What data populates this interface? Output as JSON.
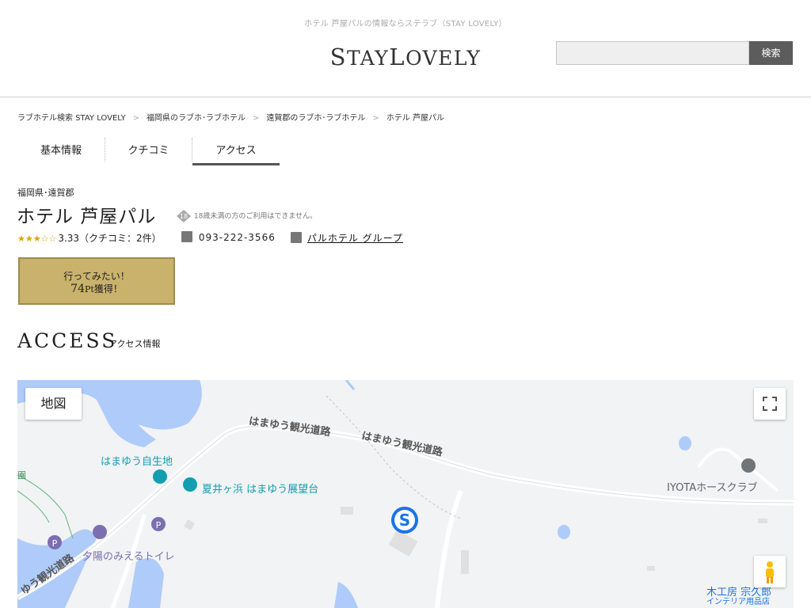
{
  "header": {
    "tagline": "ホテル 芦屋パルの情報ならステラブ（STAY LOVELY）",
    "logo_small1": "S",
    "logo_text1": "TAY",
    "logo_small2": "L",
    "logo_text2": "OVELY",
    "search_placeholder": "",
    "search_button": "検索"
  },
  "breadcrumb": [
    "ラブホテル検索 STAY LOVELY",
    "福岡県のラブホ･ラブホテル",
    "遠賀郡のラブホ･ラブホテル",
    "ホテル 芦屋パル"
  ],
  "breadcrumb_sep": ">",
  "tabs": [
    {
      "label": "基本情報",
      "active": false
    },
    {
      "label": "クチコミ",
      "active": false
    },
    {
      "label": "アクセス",
      "active": true
    }
  ],
  "hotel": {
    "prefecture": "福岡県･遠賀郡",
    "name": "ホテル 芦屋パル",
    "age_notice": "18歳未満の方のご利用はできません。",
    "stars": "★★★☆☆",
    "rating": "3.33",
    "review_text": "（クチコミ：2件）",
    "phone": "093-222-3566",
    "group": "パルホテル グループ"
  },
  "want_to_go": {
    "line1": "行ってみたい！",
    "points": "74",
    "unit": "Pt",
    "suffix": "獲得！"
  },
  "access": {
    "heading": "ACCESS",
    "sub": "アクセス情報"
  },
  "map": {
    "type_button": "地図",
    "labels": {
      "road1": "はまゆう観光道路",
      "road2": "はまゆう観光道路",
      "road3": "ゆう観光道路",
      "shelter": "はまゆう自生地",
      "observatory": "夏井ヶ浜 はまゆう展望台",
      "horse_club": "IYOTAホースクラブ",
      "toilet": "夕陽のみえるトイレ",
      "shop1": "木工房 宗久郎",
      "shop2": "インテリア用品店",
      "park": "園"
    },
    "colors": {
      "water": "#aecbfa",
      "land": "#f1f3f4",
      "road": "#ffffff",
      "teal": "#129eaf",
      "parking": "#7b6fb0",
      "marker": "#1a73e8"
    }
  }
}
